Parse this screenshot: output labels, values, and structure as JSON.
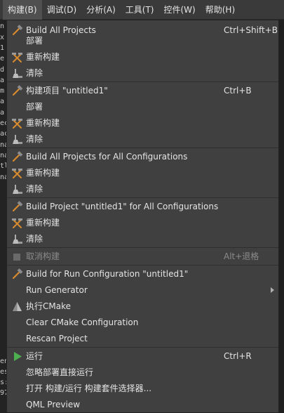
{
  "menubar": {
    "items": [
      {
        "label": "构建(B)"
      },
      {
        "label": "调试(D)"
      },
      {
        "label": "分析(A)"
      },
      {
        "label": "工具(T)"
      },
      {
        "label": "控件(W)"
      },
      {
        "label": "帮助(H)"
      }
    ]
  },
  "background": {
    "left_text": [
      "n",
      "x",
      "1",
      "e",
      "d",
      "a",
      "m",
      "a",
      "a",
      "ec",
      "ac",
      "na",
      "na",
      "tl",
      "na",
      "",
      "",
      "",
      "",
      "",
      "",
      "",
      "",
      "",
      "",
      "",
      "",
      "",
      "",
      "",
      "",
      "",
      "",
      "",
      "",
      "",
      "",
      "",
      "",
      "",
      "",
      "en",
      "es",
      "s:",
      "97"
    ]
  },
  "menu": {
    "items": [
      {
        "label": "Build All Projects",
        "shortcut": "Ctrl+Shift+B",
        "icon": "hammer-icon"
      },
      {
        "label": "部署",
        "shortcut": "",
        "icon": ""
      },
      {
        "label": "重新构建",
        "shortcut": "",
        "icon": "rebuild-hammers-icon"
      },
      {
        "label": "清除",
        "shortcut": "",
        "icon": "clean-broom-icon"
      },
      {
        "label": "构建项目 \"untitled1\"",
        "shortcut": "Ctrl+B",
        "icon": "hammer-icon"
      },
      {
        "label": "部署",
        "shortcut": "",
        "icon": ""
      },
      {
        "label": "重新构建",
        "shortcut": "",
        "icon": "rebuild-hammers-icon"
      },
      {
        "label": "清除",
        "shortcut": "",
        "icon": "clean-broom-icon"
      },
      {
        "label": "Build All Projects for All Configurations",
        "shortcut": "",
        "icon": "hammer-icon"
      },
      {
        "label": "重新构建",
        "shortcut": "",
        "icon": "rebuild-hammers-icon"
      },
      {
        "label": "清除",
        "shortcut": "",
        "icon": "clean-broom-icon"
      },
      {
        "label": "Build Project \"untitled1\" for All Configurations",
        "shortcut": "",
        "icon": "hammer-icon"
      },
      {
        "label": "重新构建",
        "shortcut": "",
        "icon": "rebuild-hammers-icon"
      },
      {
        "label": "清除",
        "shortcut": "",
        "icon": "clean-broom-icon"
      },
      {
        "label": "取消构建",
        "shortcut": "Alt+退格",
        "icon": "stop-square-icon",
        "disabled": true
      },
      {
        "label": "Build for Run Configuration \"untitled1\"",
        "shortcut": "",
        "icon": "hammer-icon"
      },
      {
        "label": "Run Generator",
        "shortcut": "",
        "icon": "",
        "submenu": true
      },
      {
        "label": "执行CMake",
        "shortcut": "",
        "icon": "cmake-icon"
      },
      {
        "label": "Clear CMake Configuration",
        "shortcut": "",
        "icon": ""
      },
      {
        "label": "Rescan Project",
        "shortcut": "",
        "icon": ""
      },
      {
        "label": "运行",
        "shortcut": "Ctrl+R",
        "icon": "play-icon"
      },
      {
        "label": "忽略部署直接运行",
        "shortcut": "",
        "icon": ""
      },
      {
        "label": "打开 构建/运行 构建套件选择器...",
        "shortcut": "",
        "icon": ""
      },
      {
        "label": "QML Preview",
        "shortcut": "",
        "icon": ""
      }
    ]
  },
  "colors": {
    "menu_bg": "#404040",
    "menubar_bg": "#3a3a3a",
    "hammer": "#d88a2e",
    "play": "#4caf50"
  }
}
